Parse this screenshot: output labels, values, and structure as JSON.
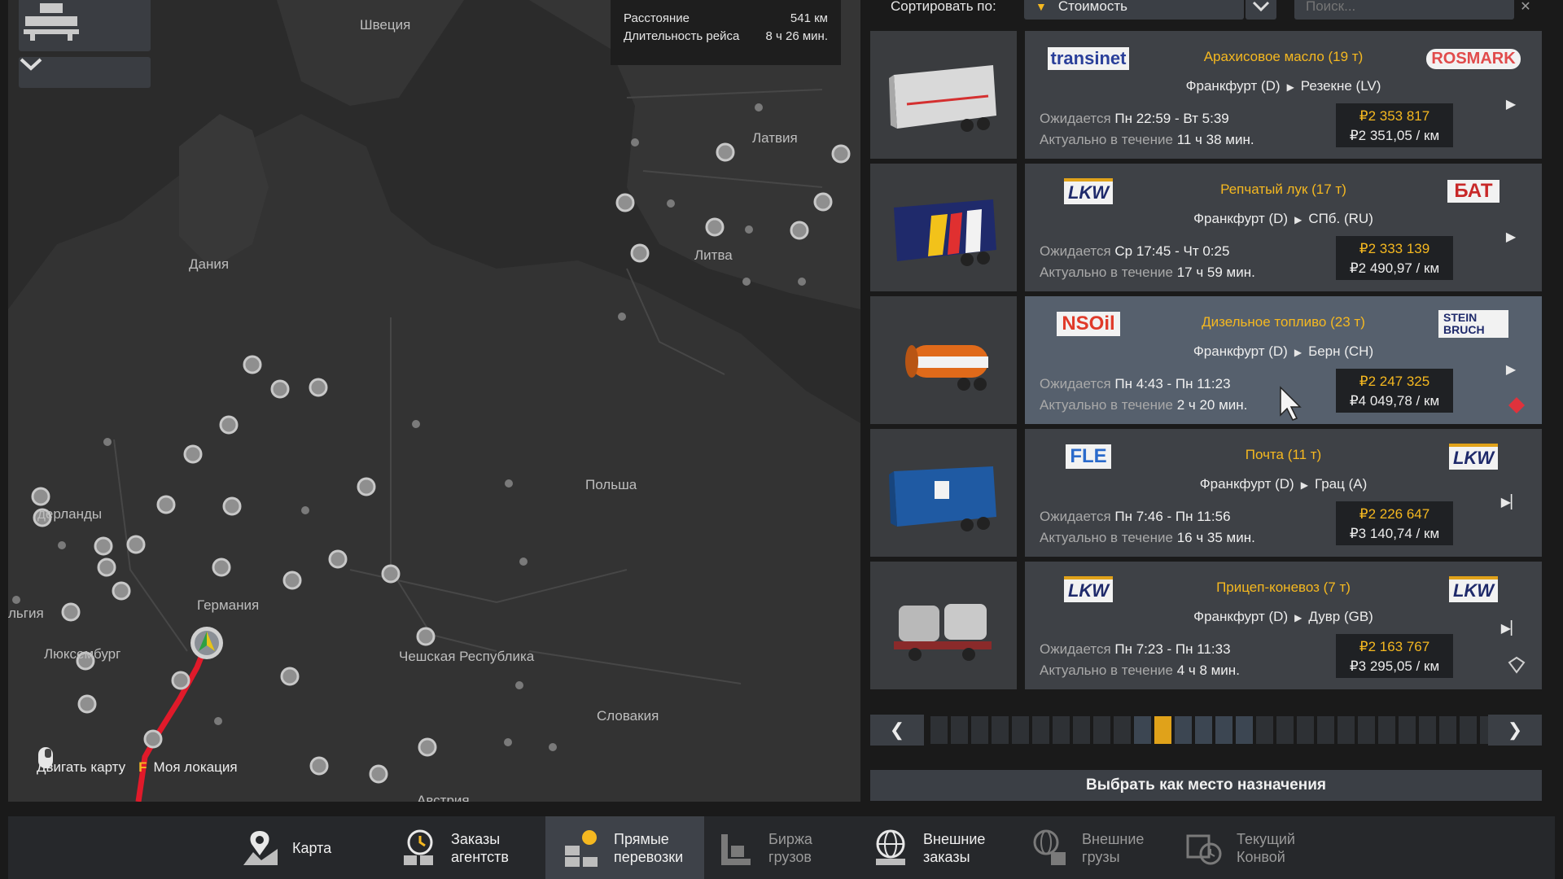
{
  "map": {
    "info": {
      "distance_label": "Расстояние",
      "distance_value": "541 км",
      "duration_label": "Длительность рейса",
      "duration_value": "8 ч 26 мин."
    },
    "countries": {
      "sweden": "Швеция",
      "latvia": "Латвия",
      "lithuania": "Литва",
      "denmark": "Дания",
      "netherlands": "дерланды",
      "germany": "Германия",
      "poland": "Польша",
      "belgium": "льгия",
      "luxembourg": "Люксембург",
      "czech": "Чешская Республика",
      "slovakia": "Словакия",
      "austria": "Австрия"
    },
    "hints": {
      "move_map": "Двигать карту",
      "my_location_key": "F",
      "my_location": "Моя локация"
    }
  },
  "sort": {
    "label": "Сортировать по:",
    "value": "Стоимость",
    "search_placeholder": "Поиск..."
  },
  "jobs": [
    {
      "company_from": "transinet",
      "company_to": "ROSMARK",
      "cargo": "Арахисовое масло (19 т)",
      "from": "Франкфурт (D)",
      "to": "Резекне (LV)",
      "expected_label": "Ожидается",
      "expected": "Пн 22:59 - Вт 5:39",
      "valid_label": "Актуально в течение",
      "valid": "11 ч 38 мин.",
      "price": "₽2 353 817",
      "per_km": "₽2 351,05 / км",
      "trailer_color": "#d9d9d9",
      "badge": ""
    },
    {
      "company_from": "LKW",
      "company_to": "БАТ",
      "cargo": "Репчатый лук (17 т)",
      "from": "Франкфурт (D)",
      "to": "СПб. (RU)",
      "expected_label": "Ожидается",
      "expected": "Ср 17:45 - Чт 0:25",
      "valid_label": "Актуально в течение",
      "valid": "17 ч 59 мин.",
      "price": "₽2 333 139",
      "per_km": "₽2 490,97 / км",
      "trailer_color": "#1f2a6b",
      "badge": ""
    },
    {
      "company_from": "NSOil",
      "company_to": "STEIN BRUCH",
      "cargo": "Дизельное топливо (23 т)",
      "from": "Франкфурт (D)",
      "to": "Берн (CH)",
      "expected_label": "Ожидается",
      "expected": "Пн 4:43 - Пн 11:23",
      "valid_label": "Актуально в течение",
      "valid": "2 ч 20 мин.",
      "price": "₽2 247 325",
      "per_km": "₽4 049,78 / км",
      "trailer_color": "#e06a1a",
      "badge": "hazard"
    },
    {
      "company_from": "FLE",
      "company_to": "LKW",
      "cargo": "Почта (11 т)",
      "from": "Франкфурт (D)",
      "to": "Грац (A)",
      "expected_label": "Ожидается",
      "expected": "Пн 7:46 - Пн 11:56",
      "valid_label": "Актуально в течение",
      "valid": "16 ч 35 мин.",
      "price": "₽2 226 647",
      "per_km": "₽3 140,74 / км",
      "trailer_color": "#1f5aa3",
      "badge": ""
    },
    {
      "company_from": "LKW",
      "company_to": "LKW",
      "cargo": "Прицеп-коневоз (7 т)",
      "from": "Франкфурт (D)",
      "to": "Дувр (GB)",
      "expected_label": "Ожидается",
      "expected": "Пн 7:23 - Пн 11:33",
      "valid_label": "Актуально в течение",
      "valid": "4 ч 8 мин.",
      "price": "₽2 163 767",
      "per_km": "₽3 295,05 / км",
      "trailer_color": "#9a9a9a",
      "badge": "special"
    }
  ],
  "pager": {
    "pages": 30,
    "active_index": 11,
    "highlight_from": 10,
    "highlight_to": 15
  },
  "select_destination": "Выбрать как место назначения",
  "tabs": [
    {
      "l1": "Карта",
      "l2": "",
      "icon": "map-icon",
      "active": false,
      "dim": false
    },
    {
      "l1": "Заказы",
      "l2": "агентств",
      "icon": "clock-board-icon",
      "active": false,
      "dim": false
    },
    {
      "l1": "Прямые",
      "l2": "перевозки",
      "icon": "boxes-icon",
      "active": true,
      "dim": false
    },
    {
      "l1": "Биржа",
      "l2": "грузов",
      "icon": "freight-market-icon",
      "active": false,
      "dim": true
    },
    {
      "l1": "Внешние",
      "l2": "заказы",
      "icon": "globe-icon",
      "active": false,
      "dim": false
    },
    {
      "l1": "Внешние",
      "l2": "грузы",
      "icon": "globe-cargo-icon",
      "active": false,
      "dim": true
    },
    {
      "l1": "Текущий",
      "l2": "Конвой",
      "icon": "convoy-icon",
      "active": false,
      "dim": true
    }
  ],
  "colors": {
    "accent": "#f5b820",
    "card": "#3e4146",
    "selected_card": "#56606d",
    "route": "#e01a2a"
  }
}
